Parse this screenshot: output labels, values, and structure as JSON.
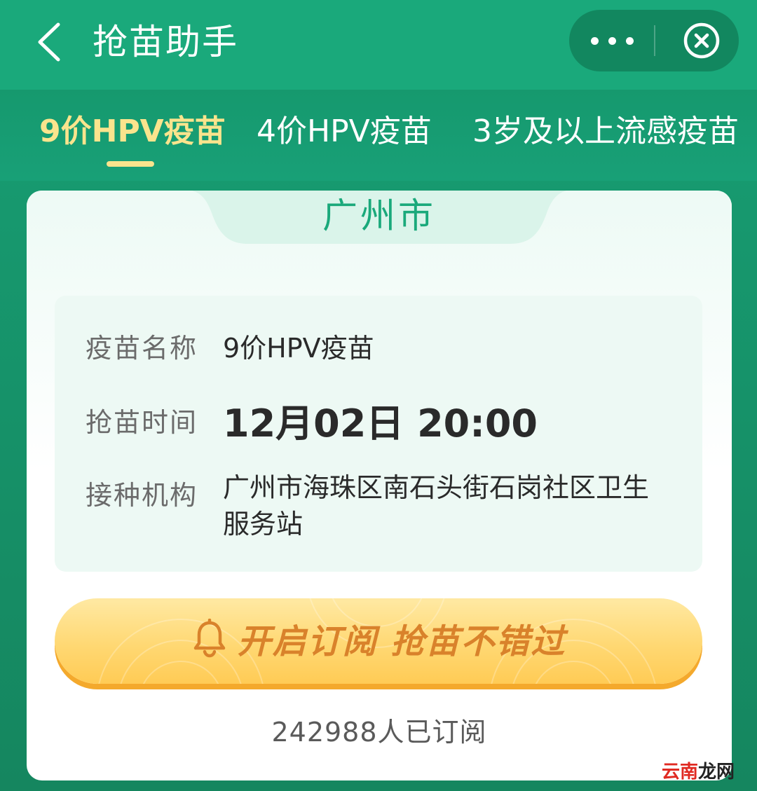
{
  "app": {
    "title": "抢苗助手",
    "back_icon": "chevron-left-icon",
    "more_icon": "more-dots-icon",
    "close_icon": "close-circle-icon"
  },
  "tabs": [
    {
      "label": "9价HPV疫苗",
      "active": true
    },
    {
      "label": "4价HPV疫苗",
      "active": false
    },
    {
      "label": "3岁及以上流感疫苗",
      "active": false
    }
  ],
  "card": {
    "city": "广州市",
    "fields": {
      "vaccine_name_label": "疫苗名称",
      "vaccine_name_value": "9价HPV疫苗",
      "time_label": "抢苗时间",
      "time_value": "12月02日 20:00",
      "org_label": "接种机构",
      "org_value": "广州市海珠区南石头街石岗社区卫生服务站"
    },
    "subscribe_button": {
      "label": "开启订阅 抢苗不错过",
      "icon": "bell-icon"
    },
    "subscriber_count": "242988人已订阅"
  },
  "watermark": {
    "part1": "云南",
    "part2": "龙网"
  },
  "colors": {
    "brand_green": "#1aa97b",
    "tab_active": "#fae48d",
    "button_text": "#d9822b",
    "button_fill": "#ffd873"
  }
}
